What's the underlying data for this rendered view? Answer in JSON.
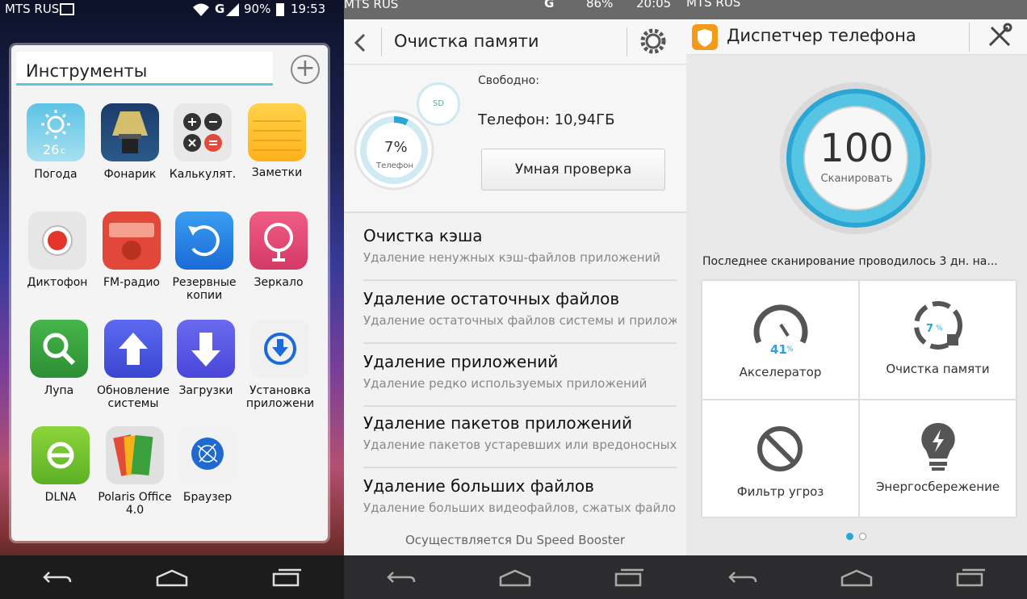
{
  "panel1": {
    "status": {
      "carrier": "MTS RUS",
      "network": "G",
      "battery": "90%",
      "time": "19:53"
    },
    "folder_title": "Инструменты",
    "apps": [
      {
        "label": "Погода",
        "temp": "26",
        "unit": "c"
      },
      {
        "label": "Фонарик"
      },
      {
        "label": "Калькулят."
      },
      {
        "label": "Заметки"
      },
      {
        "label": "Диктофон"
      },
      {
        "label": "FM-радио"
      },
      {
        "label": "Резервные копии"
      },
      {
        "label": "Зеркало"
      },
      {
        "label": "Лупа"
      },
      {
        "label": "Обновление системы"
      },
      {
        "label": "Загрузки"
      },
      {
        "label": "Установка приложени"
      },
      {
        "label": "DLNA"
      },
      {
        "label": "Polaris Office 4.0"
      },
      {
        "label": "Браузер"
      }
    ]
  },
  "panel2": {
    "status": {
      "carrier": "MTS RUS",
      "network": "G",
      "battery": "86%",
      "time": "20:05"
    },
    "title": "Очистка памяти",
    "ring": {
      "percent": "7%",
      "label": "Телефон",
      "fill": 0.07
    },
    "sd_label": "SD",
    "free_label": "Свободно:",
    "phone_free": "Телефон: 10,94ГБ",
    "smart_button": "Умная проверка",
    "items": [
      {
        "title": "Очистка кэша",
        "subtitle": "Удаление ненужных кэш-файлов приложений"
      },
      {
        "title": "Удаление остаточных файлов",
        "subtitle": "Удаление остаточных файлов системы и прилож"
      },
      {
        "title": "Удаление приложений",
        "subtitle": "Удаление редко используемых приложений"
      },
      {
        "title": "Удаление пакетов приложений",
        "subtitle": "Удаление пакетов устаревших или вредоносных"
      },
      {
        "title": "Удаление больших файлов",
        "subtitle": "Удаление больших видеофайлов, сжатых файло"
      }
    ],
    "footer": "Осуществляется Du Speed Booster"
  },
  "panel3": {
    "status": {
      "carrier": "MTS RUS"
    },
    "title": "Диспетчер телефона",
    "score": "100",
    "scan_label": "Сканировать",
    "last_scan": "Последнее сканирование проводилось 3 дн. на...",
    "tiles": [
      {
        "label": "Акселератор",
        "value": "41",
        "unit": "%"
      },
      {
        "label": "Очистка памяти",
        "value": "7",
        "unit": "%"
      },
      {
        "label": "Фильтр угроз"
      },
      {
        "label": "Энергосбережение"
      }
    ],
    "pages": 2,
    "active_page": 1
  },
  "colors": {
    "accent": "#2ba6d4",
    "ring": "#33b3d6"
  },
  "icons": [
    "weather-icon",
    "flashlight-icon",
    "calculator-icon",
    "notes-icon",
    "recorder-icon",
    "radio-icon",
    "backup-icon",
    "mirror-icon",
    "magnifier-icon",
    "update-icon",
    "download-icon",
    "install-icon",
    "dlna-icon",
    "polaris-icon",
    "browser-icon",
    "back-icon",
    "home-icon",
    "recents-icon",
    "gear-icon",
    "wrench-icon",
    "shield-icon",
    "speedometer-icon",
    "broom-icon",
    "block-icon",
    "bulb-icon"
  ]
}
